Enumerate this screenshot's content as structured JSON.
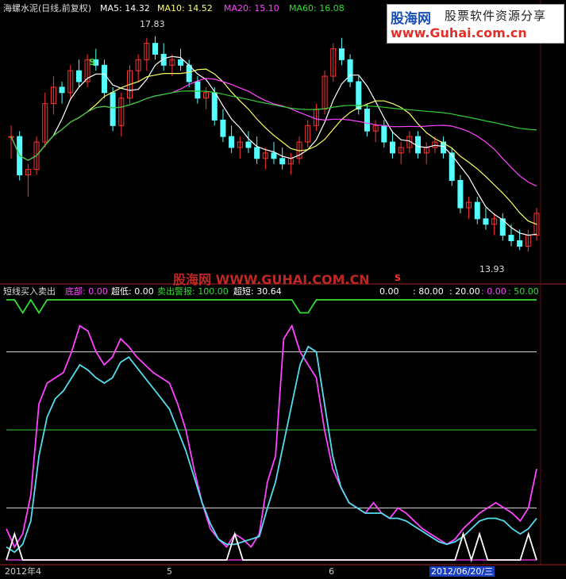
{
  "top_header": {
    "title": "海螺水泥(日线,前复权)",
    "ma5": "MA5: 14.32",
    "ma10": "MA10: 14.52",
    "ma20": "MA20: 15.10",
    "ma60": "MA60: 16.08",
    "high_label": "17.83",
    "low_label": "13.93",
    "signal_s_top": "S",
    "signal_s_bottom": "S"
  },
  "watermark": {
    "brand": "股海网",
    "tagline": "股票软件资源分享",
    "url": "www.Guhai.com.cn",
    "overlay": "股海网 WWW.GUHAI.COM.CN"
  },
  "indicator_header": {
    "title": "短线买入卖出",
    "bottom": "底部: 0.00",
    "oversold": "超低: 0.00",
    "sell_warn": "卖出警报: 100.00",
    "overbought": "超短: 30.64",
    "frag1": "0.00",
    "frag2": ": 80.00",
    "frag3": ": 20.00",
    "frag4": ": 0.00",
    "frag5": ": 50.00"
  },
  "date_axis": {
    "d1": "2012年4",
    "d2": "5",
    "d3": "6",
    "cursor": "2012/06/20/三"
  },
  "colors": {
    "up": "#ff3333",
    "down": "#54ffff",
    "ma5": "#ffffff",
    "ma10": "#ffff66",
    "ma20": "#ff44ff",
    "ma60": "#33cc33",
    "magenta_line": "#ff44ff",
    "cyan_line": "#55ddee",
    "green_line": "#33dd33",
    "white_line": "#ffffff",
    "header_white": "#dddddd",
    "header_magenta": "#ff44ff",
    "header_green": "#33dd33",
    "header_yellow": "#ffff33"
  },
  "chart_data": [
    {
      "type": "candlestick",
      "title": "海螺水泥(日线,前复权)",
      "series": [
        {
          "name": "MA5",
          "value": 14.32
        },
        {
          "name": "MA10",
          "value": 14.52
        },
        {
          "name": "MA20",
          "value": 15.1
        },
        {
          "name": "MA60",
          "value": 16.08
        }
      ],
      "annotations": [
        {
          "text": "17.83",
          "kind": "high"
        },
        {
          "text": "13.93",
          "kind": "low"
        }
      ],
      "ylim": [
        13.5,
        18.2
      ],
      "candles": [
        [
          16.0,
          16.2,
          15.6,
          16.0
        ],
        [
          16.0,
          16.1,
          15.2,
          15.3
        ],
        [
          15.3,
          15.5,
          14.9,
          15.4
        ],
        [
          15.4,
          16.0,
          15.3,
          15.9
        ],
        [
          15.9,
          16.8,
          15.8,
          16.6
        ],
        [
          16.6,
          17.1,
          16.4,
          16.9
        ],
        [
          16.9,
          17.0,
          16.6,
          16.8
        ],
        [
          16.8,
          17.3,
          16.7,
          17.2
        ],
        [
          17.2,
          17.4,
          16.9,
          17.0
        ],
        [
          17.0,
          17.5,
          16.9,
          17.4
        ],
        [
          17.4,
          17.6,
          17.2,
          17.3
        ],
        [
          17.3,
          17.4,
          16.7,
          16.8
        ],
        [
          16.8,
          16.9,
          16.1,
          16.2
        ],
        [
          16.2,
          16.8,
          16.0,
          16.7
        ],
        [
          16.7,
          17.3,
          16.6,
          17.2
        ],
        [
          17.2,
          17.5,
          17.0,
          17.4
        ],
        [
          17.4,
          17.8,
          17.2,
          17.7
        ],
        [
          17.7,
          17.83,
          17.4,
          17.5
        ],
        [
          17.5,
          17.7,
          17.2,
          17.3
        ],
        [
          17.3,
          17.5,
          17.1,
          17.4
        ],
        [
          17.4,
          17.6,
          17.2,
          17.3
        ],
        [
          17.3,
          17.4,
          16.9,
          17.0
        ],
        [
          17.0,
          17.1,
          16.6,
          16.7
        ],
        [
          16.7,
          16.9,
          16.5,
          16.8
        ],
        [
          16.8,
          16.9,
          16.2,
          16.3
        ],
        [
          16.3,
          16.5,
          15.9,
          16.0
        ],
        [
          16.0,
          16.2,
          15.7,
          15.8
        ],
        [
          15.8,
          16.0,
          15.6,
          15.9
        ],
        [
          15.9,
          16.1,
          15.7,
          15.8
        ],
        [
          15.8,
          16.0,
          15.5,
          15.6
        ],
        [
          15.6,
          15.8,
          15.4,
          15.7
        ],
        [
          15.7,
          15.9,
          15.5,
          15.6
        ],
        [
          15.6,
          15.8,
          15.4,
          15.5
        ],
        [
          15.5,
          15.7,
          15.3,
          15.6
        ],
        [
          15.6,
          16.0,
          15.5,
          15.9
        ],
        [
          15.9,
          16.3,
          15.8,
          16.2
        ],
        [
          16.2,
          16.6,
          16.1,
          16.5
        ],
        [
          16.5,
          17.2,
          16.4,
          17.1
        ],
        [
          17.1,
          17.7,
          17.0,
          17.6
        ],
        [
          17.6,
          17.8,
          17.3,
          17.4
        ],
        [
          17.4,
          17.5,
          16.9,
          17.0
        ],
        [
          17.0,
          17.1,
          16.4,
          16.5
        ],
        [
          16.5,
          16.6,
          16.0,
          16.1
        ],
        [
          16.1,
          16.3,
          15.9,
          16.2
        ],
        [
          16.2,
          16.3,
          15.8,
          15.9
        ],
        [
          15.9,
          16.1,
          15.6,
          15.7
        ],
        [
          15.7,
          15.9,
          15.5,
          15.8
        ],
        [
          15.8,
          16.1,
          15.7,
          16.0
        ],
        [
          16.0,
          16.1,
          15.6,
          15.7
        ],
        [
          15.7,
          15.9,
          15.5,
          15.8
        ],
        [
          15.8,
          16.0,
          15.7,
          15.9
        ],
        [
          15.9,
          16.0,
          15.6,
          15.7
        ],
        [
          15.7,
          15.8,
          15.1,
          15.2
        ],
        [
          15.2,
          15.3,
          14.6,
          14.7
        ],
        [
          14.7,
          14.9,
          14.5,
          14.8
        ],
        [
          14.8,
          14.9,
          14.4,
          14.5
        ],
        [
          14.5,
          14.7,
          14.3,
          14.4
        ],
        [
          14.4,
          14.6,
          14.2,
          14.5
        ],
        [
          14.5,
          14.6,
          14.1,
          14.2
        ],
        [
          14.2,
          14.4,
          14.0,
          14.1
        ],
        [
          14.1,
          14.3,
          13.93,
          14.0
        ],
        [
          14.0,
          14.3,
          13.9,
          14.2
        ],
        [
          14.2,
          14.7,
          14.1,
          14.6
        ]
      ]
    },
    {
      "type": "line",
      "title": "短线买入卖出",
      "ylim": [
        0,
        100
      ],
      "guides": [
        80,
        50,
        20
      ],
      "series": [
        {
          "name": "底部",
          "values": [
            12,
            5,
            10,
            25,
            60,
            68,
            70,
            72,
            80,
            90,
            88,
            80,
            75,
            78,
            85,
            82,
            78,
            75,
            72,
            70,
            68,
            60,
            50,
            35,
            22,
            12,
            8,
            5,
            10,
            8,
            5,
            10,
            30,
            40,
            85,
            90,
            80,
            75,
            70,
            50,
            35,
            28,
            22,
            20,
            18,
            22,
            18,
            16,
            20,
            18,
            15,
            12,
            10,
            8,
            6,
            8,
            12,
            15,
            18,
            20,
            22,
            20,
            18,
            15,
            20,
            35
          ]
        },
        {
          "name": "超低",
          "values": [
            5,
            3,
            6,
            15,
            40,
            55,
            62,
            65,
            70,
            75,
            73,
            70,
            68,
            70,
            76,
            78,
            74,
            70,
            66,
            62,
            58,
            50,
            42,
            32,
            22,
            14,
            8,
            6,
            6,
            7,
            8,
            9,
            20,
            30,
            45,
            60,
            75,
            82,
            80,
            60,
            40,
            28,
            22,
            20,
            18,
            18,
            18,
            16,
            16,
            15,
            13,
            11,
            9,
            7,
            6,
            7,
            9,
            12,
            15,
            16,
            16,
            15,
            12,
            10,
            12,
            16
          ]
        },
        {
          "name": "卖出警报",
          "values": [
            100,
            100,
            95,
            100,
            95,
            100,
            100,
            100,
            100,
            100,
            100,
            100,
            100,
            100,
            100,
            100,
            100,
            100,
            100,
            100,
            100,
            100,
            100,
            100,
            100,
            100,
            100,
            100,
            100,
            100,
            100,
            100,
            100,
            100,
            100,
            100,
            95,
            95,
            100,
            100,
            100,
            100,
            100,
            100,
            100,
            100,
            100,
            100,
            100,
            100,
            100,
            100,
            100,
            100,
            100,
            100,
            100,
            100,
            100,
            100,
            100,
            100,
            100,
            100,
            100,
            100
          ]
        },
        {
          "name": "超短",
          "values": [
            0,
            10,
            0,
            0,
            0,
            0,
            0,
            0,
            0,
            0,
            0,
            0,
            0,
            0,
            0,
            0,
            0,
            0,
            0,
            0,
            0,
            0,
            0,
            0,
            0,
            0,
            0,
            0,
            10,
            0,
            0,
            0,
            0,
            0,
            0,
            0,
            0,
            0,
            0,
            0,
            0,
            0,
            0,
            0,
            0,
            0,
            0,
            0,
            0,
            0,
            0,
            0,
            0,
            0,
            0,
            0,
            10,
            0,
            10,
            0,
            0,
            0,
            0,
            0,
            10,
            0
          ]
        }
      ]
    }
  ]
}
